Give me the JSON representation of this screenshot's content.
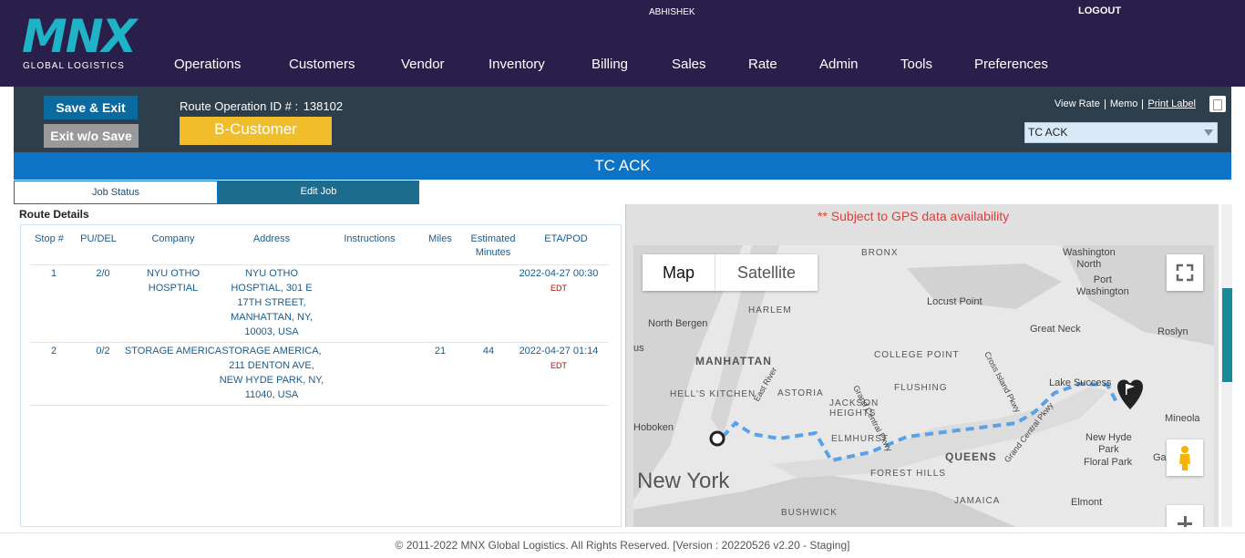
{
  "header": {
    "logo_text": "MNX",
    "logo_sub": "GLOBAL LOGISTICS",
    "username": "ABHISHEK",
    "logout": "LOGOUT",
    "nav": [
      "Operations",
      "Customers",
      "Vendor",
      "Inventory",
      "Billing",
      "Sales",
      "Rate",
      "Admin",
      "Tools",
      "Preferences"
    ]
  },
  "opbar": {
    "save_exit": "Save & Exit",
    "exit_no_save": "Exit w/o Save",
    "route_id_label": "Route Operation ID # :",
    "route_id": "138102",
    "badge": "B-Customer",
    "links": {
      "view_rate": "View Rate",
      "memo": "Memo",
      "print_label": "Print Label"
    },
    "select_value": "TC ACK"
  },
  "title": "TC ACK",
  "tabs": {
    "job_status": "Job Status",
    "edit_job": "Edit Job"
  },
  "route": {
    "heading": "Route Details",
    "columns": [
      "Stop #",
      "PU/DEL",
      "Company",
      "Address",
      "Instructions",
      "Miles",
      "Estimated Minutes",
      "ETA/POD"
    ],
    "rows": [
      {
        "stop": "1",
        "pudel": "2/0",
        "company": "NYU OTHO HOSPTIAL",
        "address": "NYU OTHO HOSPTIAL, 301 E 17TH STREET, MANHATTAN, NY, 10003, USA",
        "instructions": "",
        "miles": "",
        "minutes": "",
        "eta": "2022-04-27 00:30",
        "tz": "EDT"
      },
      {
        "stop": "2",
        "pudel": "0/2",
        "company": "STORAGE AMERICA",
        "address": "STORAGE AMERICA, 211 DENTON AVE, NEW HYDE PARK, NY, 11040, USA",
        "instructions": "",
        "miles": "21",
        "minutes": "44",
        "eta": "2022-04-27 01:14",
        "tz": "EDT"
      }
    ]
  },
  "map": {
    "gps_note": "** Subject to GPS data availability",
    "map_btn": "Map",
    "satellite_btn": "Satellite",
    "labels": {
      "bronx": "BRONX",
      "washington_north": "Washington\nNorth",
      "port_washington": "Port\nWashington",
      "locust_point": "Locust Point",
      "harlem": "HARLEM",
      "north_bergen": "North Bergen",
      "great_neck": "Great Neck",
      "roslyn": "Roslyn",
      "college_point": "COLLEGE POINT",
      "manhattan": "MANHATTAN",
      "hells_kitchen": "HELL'S KITCHEN",
      "astoria": "ASTORIA",
      "flushing": "FLUSHING",
      "lake_success": "Lake Success",
      "jackson_heights": "JACKSON\nHEIGHTS",
      "hoboken": "Hoboken",
      "elmhurst": "ELMHURST",
      "mineola": "Mineola",
      "queens": "QUEENS",
      "new_hyde_park": "New Hyde\nPark",
      "new_york": "New York",
      "forest_hills": "FOREST HILLS",
      "floral_park": "Floral Park",
      "jamaica": "JAMAICA",
      "garden_city": "Ga",
      "bushwick": "BUSHWICK",
      "elmont": "Elmont",
      "us": "us",
      "grand_central_pkwy": "Grand Central Pkwy",
      "cross_island_pkwy": "Cross Island Pkwy",
      "grand_central_pkwy2": "Grand Central Pkwy",
      "east_river": "East River"
    }
  },
  "footer": "© 2011-2022 MNX Global Logistics. All Rights Reserved. [Version : 20220526 v2.20 - Staging]"
}
